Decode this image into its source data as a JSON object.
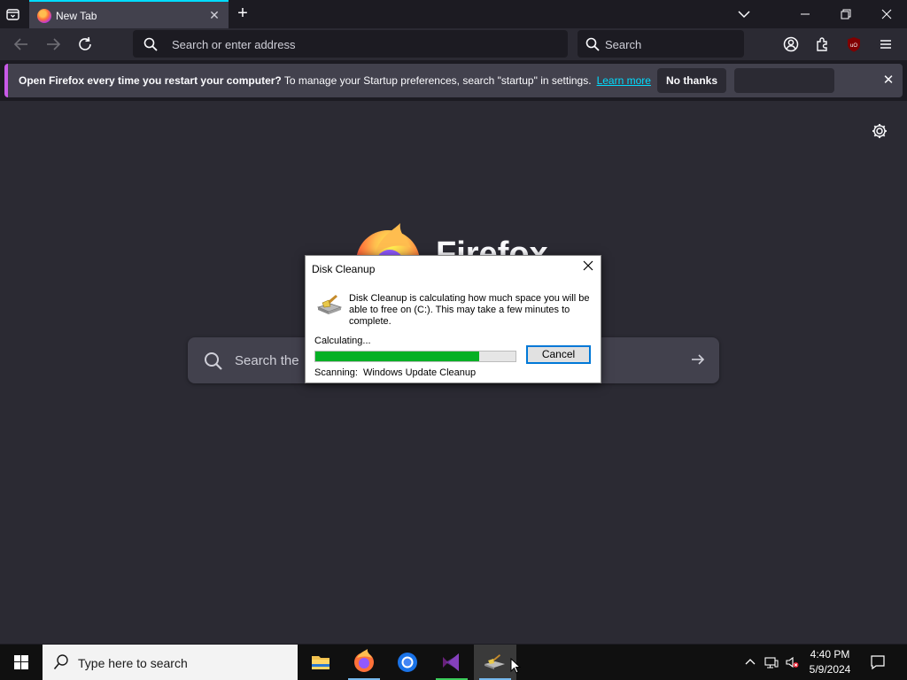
{
  "browser": {
    "tab": {
      "title": "New Tab"
    },
    "urlbar": {
      "placeholder": "Search or enter address"
    },
    "searchbar": {
      "placeholder": "Search"
    }
  },
  "notification": {
    "bold": "Open Firefox every time you restart your computer?",
    "text": " To manage your Startup preferences, search \"startup\" in settings.",
    "link": "Learn more",
    "no_thanks": "No thanks"
  },
  "newtab": {
    "wordmark": "Firefox",
    "search_placeholder": "Search the"
  },
  "dialog": {
    "title": "Disk Cleanup",
    "description": "Disk Cleanup is calculating how much space you will be able to free on  (C:). This may take a few minutes to complete.",
    "status": "Calculating...",
    "progress": 0.82,
    "cancel": "Cancel",
    "scan_label": "Scanning:",
    "scan_value": "Windows Update Cleanup"
  },
  "taskbar": {
    "search_placeholder": "Type here to search",
    "apps": [
      "file-explorer",
      "firefox",
      "chrome",
      "visual-studio",
      "disk-cleanup"
    ],
    "clock_time": "4:40 PM",
    "clock_date": "5/9/2024"
  },
  "colors": {
    "accent": "#00ddff",
    "progress": "#06b025",
    "dialog_focus": "#0078d7"
  }
}
